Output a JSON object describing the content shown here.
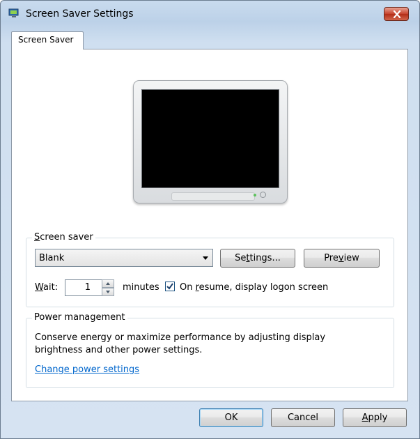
{
  "window": {
    "title": "Screen Saver Settings",
    "accent": "#c6422c"
  },
  "tabs": [
    {
      "label": "Screen Saver",
      "selected": true
    }
  ],
  "screen_saver": {
    "group_label_mnemonic": "S",
    "group_label_rest": "creen saver",
    "selected": "Blank",
    "settings_btn": {
      "pre": "Se",
      "mnemonic": "t",
      "post": "tings..."
    },
    "preview_btn": {
      "pre": "Pre",
      "mnemonic": "v",
      "post": "iew"
    },
    "wait_label_mnemonic": "W",
    "wait_label_rest": "ait:",
    "wait_value": "1",
    "minutes_label": "minutes",
    "resume_checked": true,
    "resume_label_pre": "On ",
    "resume_label_mnemonic": "r",
    "resume_label_post": "esume, display logon screen"
  },
  "power_management": {
    "group_label": "Power management",
    "description": "Conserve energy or maximize performance by adjusting display brightness and other power settings.",
    "link": "Change power settings",
    "link_color": "#0066cc"
  },
  "footer": {
    "ok_label": "OK",
    "cancel_label": "Cancel",
    "apply_mnemonic": "A",
    "apply_rest": "pply"
  }
}
